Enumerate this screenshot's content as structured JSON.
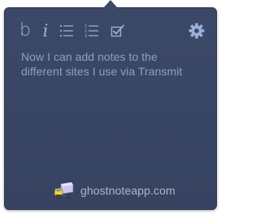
{
  "toolbar": {
    "bold_glyph": "b",
    "italic_glyph": "i",
    "icons": [
      "bold-icon",
      "italic-icon",
      "bulleted-list-icon",
      "numbered-list-icon",
      "checkbox-icon",
      "gear-icon"
    ]
  },
  "note": {
    "text": "Now I can add notes to the different sites I use via Transmit"
  },
  "footer": {
    "link_text": "ghostnoteapp.com",
    "icon": "transmit-truck-icon"
  },
  "colors": {
    "panel_background": "#3a4766",
    "icon_color": "#9ab0d6",
    "text_color": "#8ea0bf",
    "link_color": "#aab8d2"
  }
}
